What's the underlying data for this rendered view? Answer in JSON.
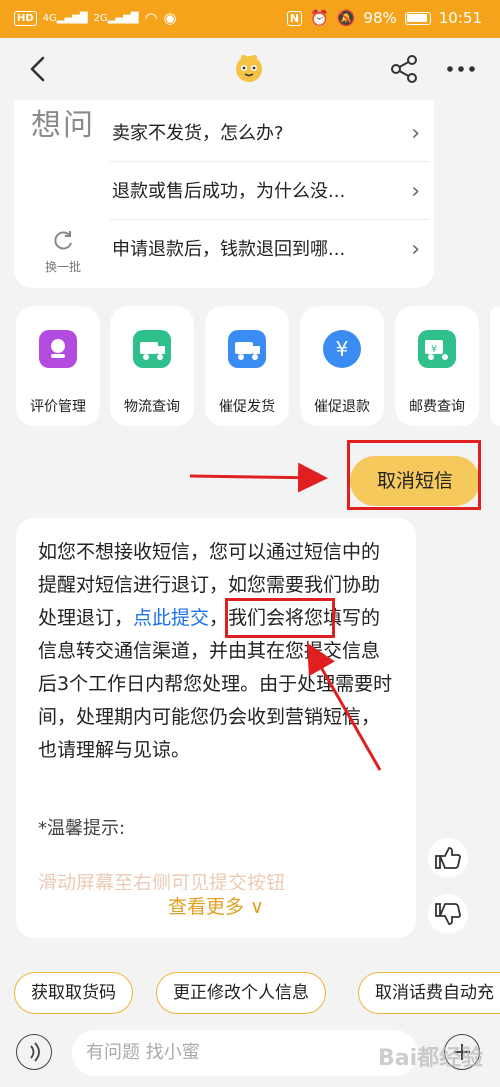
{
  "status_bar": {
    "left_chips": [
      "HD",
      "4G",
      "2G"
    ],
    "nfc": "N",
    "battery": "98%",
    "time": "10:51"
  },
  "nav": {
    "back_icon": "chevron-left-icon",
    "mascot_icon": "mascot-icon",
    "share_icon": "share-icon",
    "more_icon": "more-icon"
  },
  "faq": {
    "title": "想问",
    "refresh_label": "换一批",
    "items": [
      {
        "label": "卖家不发货，怎么办?"
      },
      {
        "label": "退款或售后成功，为什么没..."
      },
      {
        "label": "申请退款后，钱款退回到哪..."
      }
    ]
  },
  "services": [
    {
      "label": "评价管理",
      "color": "#b34be0"
    },
    {
      "label": "物流查询",
      "color": "#2fc08c"
    },
    {
      "label": "催促发货",
      "color": "#3a8cf2"
    },
    {
      "label": "催促退款",
      "color": "#3a8cf2"
    },
    {
      "label": "邮费查询",
      "color": "#2fc08c"
    }
  ],
  "user_message": "取消短信",
  "reply": {
    "part1": "如您不想接收短信，您可以通过短信中的提醒对短信进行退订，如您需要我们协助处理退订，",
    "link": "点此提交",
    "part2": "，我们会将您填写的信息转交通信渠道，并由其在您提交信息后3个工作日内帮您处理。由于处理需要时间，处理期内可能您仍会收到营销短信，也请理解与见谅。",
    "tip_title": "*温馨提示:",
    "tip_fade": "滑动屏幕至右侧可见提交按钮",
    "see_more": "查看更多 ∨"
  },
  "quick_actions": [
    {
      "label": "获取取货码"
    },
    {
      "label": "更正修改个人信息"
    },
    {
      "label": "取消话费自动充"
    }
  ],
  "input": {
    "placeholder": "有问题 找小蜜"
  },
  "watermark": "Bai都经验",
  "colors": {
    "accent": "#f6a31c",
    "link": "#1a73e8",
    "annotation": "#e02020"
  }
}
